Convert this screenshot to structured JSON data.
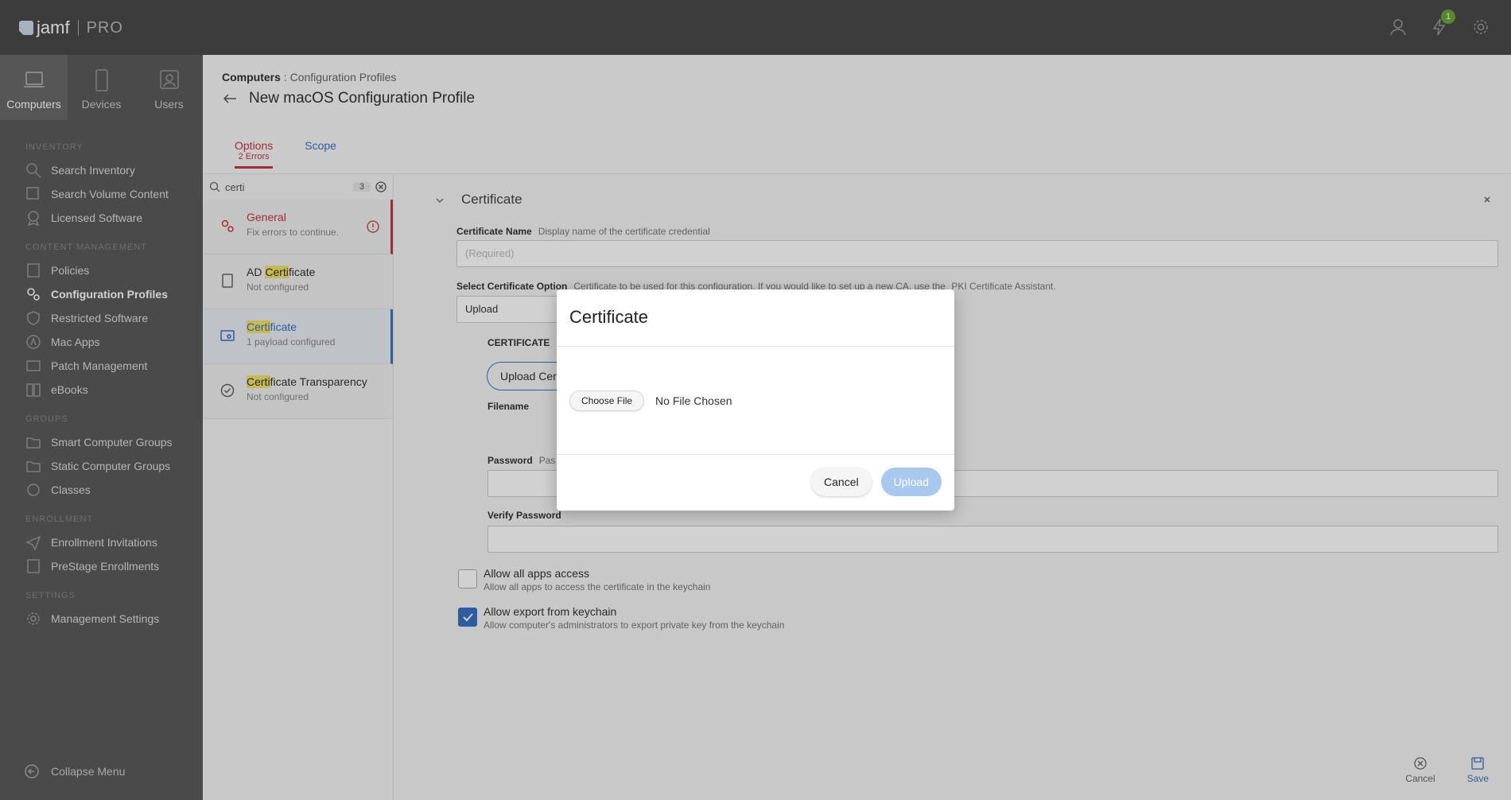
{
  "app": {
    "logo_text": "jamf",
    "logo_pro": "PRO",
    "notif_count": "1"
  },
  "sidebar": {
    "tabs": [
      {
        "label": "Computers",
        "active": true
      },
      {
        "label": "Devices",
        "active": false
      },
      {
        "label": "Users",
        "active": false
      }
    ],
    "sections": {
      "inventory": "INVENTORY",
      "content_management": "CONTENT MANAGEMENT",
      "groups": "GROUPS",
      "enrollment": "ENROLLMENT",
      "settings": "SETTINGS"
    },
    "items": {
      "search_inventory": "Search Inventory",
      "search_volume": "Search Volume Content",
      "licensed_software": "Licensed Software",
      "policies": "Policies",
      "config_profiles": "Configuration Profiles",
      "restricted_software": "Restricted Software",
      "mac_apps": "Mac Apps",
      "patch_management": "Patch Management",
      "ebooks": "eBooks",
      "smart_groups": "Smart Computer Groups",
      "static_groups": "Static Computer Groups",
      "classes": "Classes",
      "enrollment_invitations": "Enrollment Invitations",
      "prestage_enrollments": "PreStage Enrollments",
      "management_settings": "Management Settings"
    },
    "collapse": "Collapse Menu"
  },
  "header": {
    "breadcrumb_root": "Computers",
    "breadcrumb_sep": ":",
    "breadcrumb_leaf": "Configuration Profiles",
    "title": "New macOS Configuration Profile",
    "tab_options": "Options",
    "tab_options_errors": "2 Errors",
    "tab_scope": "Scope"
  },
  "payloads": {
    "search_value": "certi",
    "search_count": "3",
    "items": [
      {
        "pre": "",
        "hl": "",
        "post": "General",
        "status": "Fix errors to continue."
      },
      {
        "pre": "AD ",
        "hl": "Certi",
        "post": "ficate",
        "status": "Not configured"
      },
      {
        "pre": "",
        "hl": "Certi",
        "post": "ficate",
        "status": "1 payload configured"
      },
      {
        "pre": "",
        "hl": "Certi",
        "post": "ficate Transparency",
        "status": "Not configured"
      }
    ]
  },
  "content": {
    "section_title": "Certificate",
    "cert_name_label": "Certificate Name",
    "cert_name_hint": "Display name of the certificate credential",
    "cert_name_placeholder": "(Required)",
    "select_option_label": "Select Certificate Option",
    "select_option_hint": "Certificate to be used for this configuration. If you would like to set up a new CA, use the",
    "select_option_link": "PKI Certificate Assistant.",
    "select_value": "Upload",
    "certificate_heading": "CERTIFICATE",
    "upload_cert_btn": "Upload Cer",
    "filename_label": "Filename",
    "password_label": "Password",
    "password_hint": "Pas",
    "verify_password_label": "Verify Password",
    "allow_apps_label": "Allow all apps access",
    "allow_apps_desc": "Allow all apps to access the certificate in the keychain",
    "allow_export_label": "Allow export from keychain",
    "allow_export_desc": "Allow computer's administrators to export private key from the keychain",
    "footer_cancel": "Cancel",
    "footer_save": "Save"
  },
  "modal": {
    "title": "Certificate",
    "choose_file": "Choose File",
    "no_file": "No File Chosen",
    "cancel": "Cancel",
    "upload": "Upload"
  }
}
